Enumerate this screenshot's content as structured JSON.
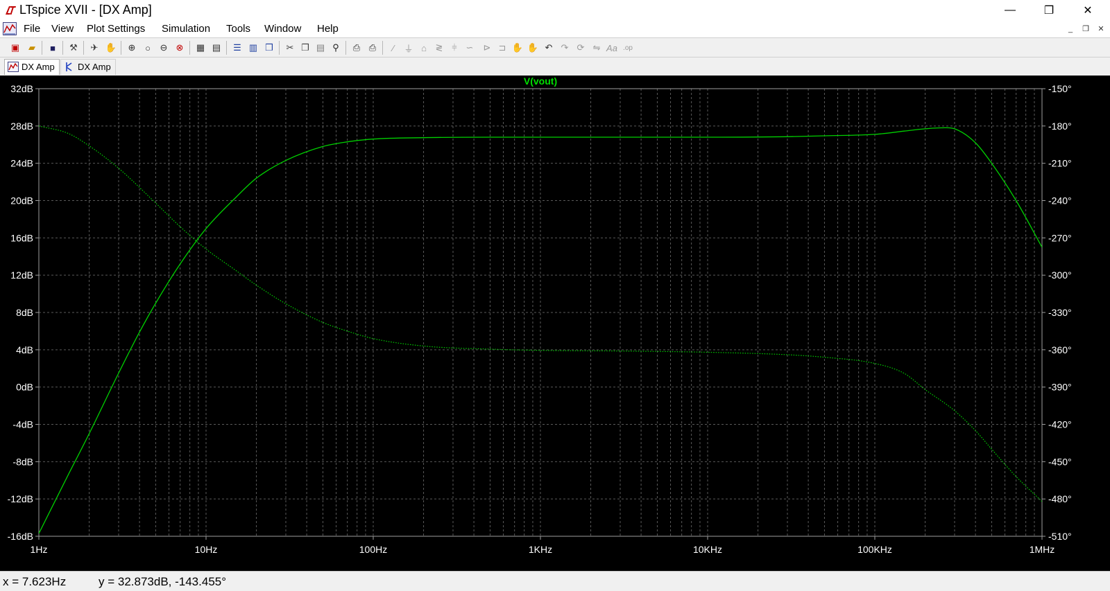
{
  "window": {
    "title": "LTspice XVII - [DX Amp]",
    "minimize": "—",
    "maximize": "❐",
    "close": "✕"
  },
  "menu": {
    "items": [
      "File",
      "View",
      "Plot Settings",
      "Simulation",
      "Tools",
      "Window",
      "Help"
    ]
  },
  "toolbar": {
    "icons": [
      "new-schematic-icon",
      "open-icon",
      "save-icon",
      "control-panel-icon",
      "run-icon",
      "halt-icon",
      "zoom-in-icon",
      "zoom-out-icon",
      "zoom-full-icon",
      "zoom-cancel-icon",
      "autorange-icon",
      "mark-trace-icon",
      "tile-horizontal-icon",
      "tile-vertical-icon",
      "cascade-icon",
      "cut-icon",
      "copy-icon",
      "paste-icon",
      "find-icon",
      "print-preview-icon",
      "print-icon",
      "wire-icon",
      "ground-icon",
      "label-icon",
      "resistor-icon",
      "capacitor-icon",
      "inductor-icon",
      "diode-icon",
      "component-icon",
      "move-icon",
      "drag-icon",
      "undo-icon",
      "redo-icon",
      "rotate-icon",
      "mirror-icon",
      "text-icon",
      "spice-directive-icon"
    ]
  },
  "tabs": [
    {
      "label": "DX Amp",
      "icon": "waveform-icon",
      "active": true
    },
    {
      "label": "DX Amp",
      "icon": "schematic-icon",
      "active": false
    }
  ],
  "chart_data": {
    "type": "line",
    "title": "V(vout)",
    "xscale": "log",
    "xlim": [
      1,
      1000000
    ],
    "x_tick_labels": [
      "1Hz",
      "10Hz",
      "100Hz",
      "1KHz",
      "10KHz",
      "100KHz",
      "1MHz"
    ],
    "ylim_left": [
      -16,
      32
    ],
    "y_left_ticks": [
      32,
      28,
      24,
      20,
      16,
      12,
      8,
      4,
      0,
      -4,
      -8,
      -12,
      -16
    ],
    "y_left_tick_labels": [
      "32dB",
      "28dB",
      "24dB",
      "20dB",
      "16dB",
      "12dB",
      "8dB",
      "4dB",
      "0dB",
      "-4dB",
      "-8dB",
      "-12dB",
      "-16dB"
    ],
    "ylim_right": [
      -510,
      -150
    ],
    "y_right_ticks": [
      -150,
      -180,
      -210,
      -240,
      -270,
      -300,
      -330,
      -360,
      -390,
      -420,
      -450,
      -480,
      -510
    ],
    "y_right_tick_labels": [
      "-150°",
      "-180°",
      "-210°",
      "-240°",
      "-270°",
      "-300°",
      "-330°",
      "-360°",
      "-390°",
      "-420°",
      "-450°",
      "-480°",
      "-510°"
    ],
    "grid": true,
    "colors": {
      "background": "#000000",
      "trace": "#00d000",
      "grid": "#5a5a5a",
      "axis_text": "#ffffff",
      "title": "#00e000"
    },
    "series": [
      {
        "axis": "left",
        "style": "solid",
        "x": [
          1,
          1.5,
          2,
          3,
          4,
          5,
          7,
          10,
          15,
          20,
          30,
          50,
          70,
          100,
          200,
          500,
          1000,
          5000,
          10000,
          30000,
          50000,
          100000,
          150000,
          200000,
          250000,
          300000,
          400000,
          500000,
          700000,
          1000000
        ],
        "y": [
          -15.7,
          -9.4,
          -5.0,
          1.5,
          5.9,
          9.0,
          13.2,
          17.0,
          20.3,
          22.4,
          24.3,
          25.8,
          26.3,
          26.6,
          26.75,
          26.8,
          26.8,
          26.8,
          26.8,
          26.85,
          26.95,
          27.1,
          27.45,
          27.7,
          27.8,
          27.7,
          26.2,
          24.0,
          20.0,
          15.0
        ]
      },
      {
        "axis": "right",
        "style": "dotted",
        "x": [
          1,
          1.5,
          2,
          3,
          5,
          7,
          10,
          15,
          20,
          30,
          50,
          70,
          100,
          200,
          500,
          1000,
          3000,
          10000,
          30000,
          50000,
          100000,
          150000,
          200000,
          300000,
          400000,
          500000,
          700000,
          1000000
        ],
        "y": [
          -180,
          -186,
          -196,
          -214,
          -242,
          -261,
          -279,
          -296,
          -308,
          -323,
          -338,
          -345,
          -351,
          -357,
          -359.5,
          -360.5,
          -361,
          -362,
          -364,
          -366,
          -371,
          -379,
          -392,
          -409,
          -425,
          -440,
          -462,
          -482
        ]
      }
    ]
  },
  "status": {
    "x_text": "x = 7.623Hz",
    "y_text": "y = 32.873dB, -143.455°"
  }
}
